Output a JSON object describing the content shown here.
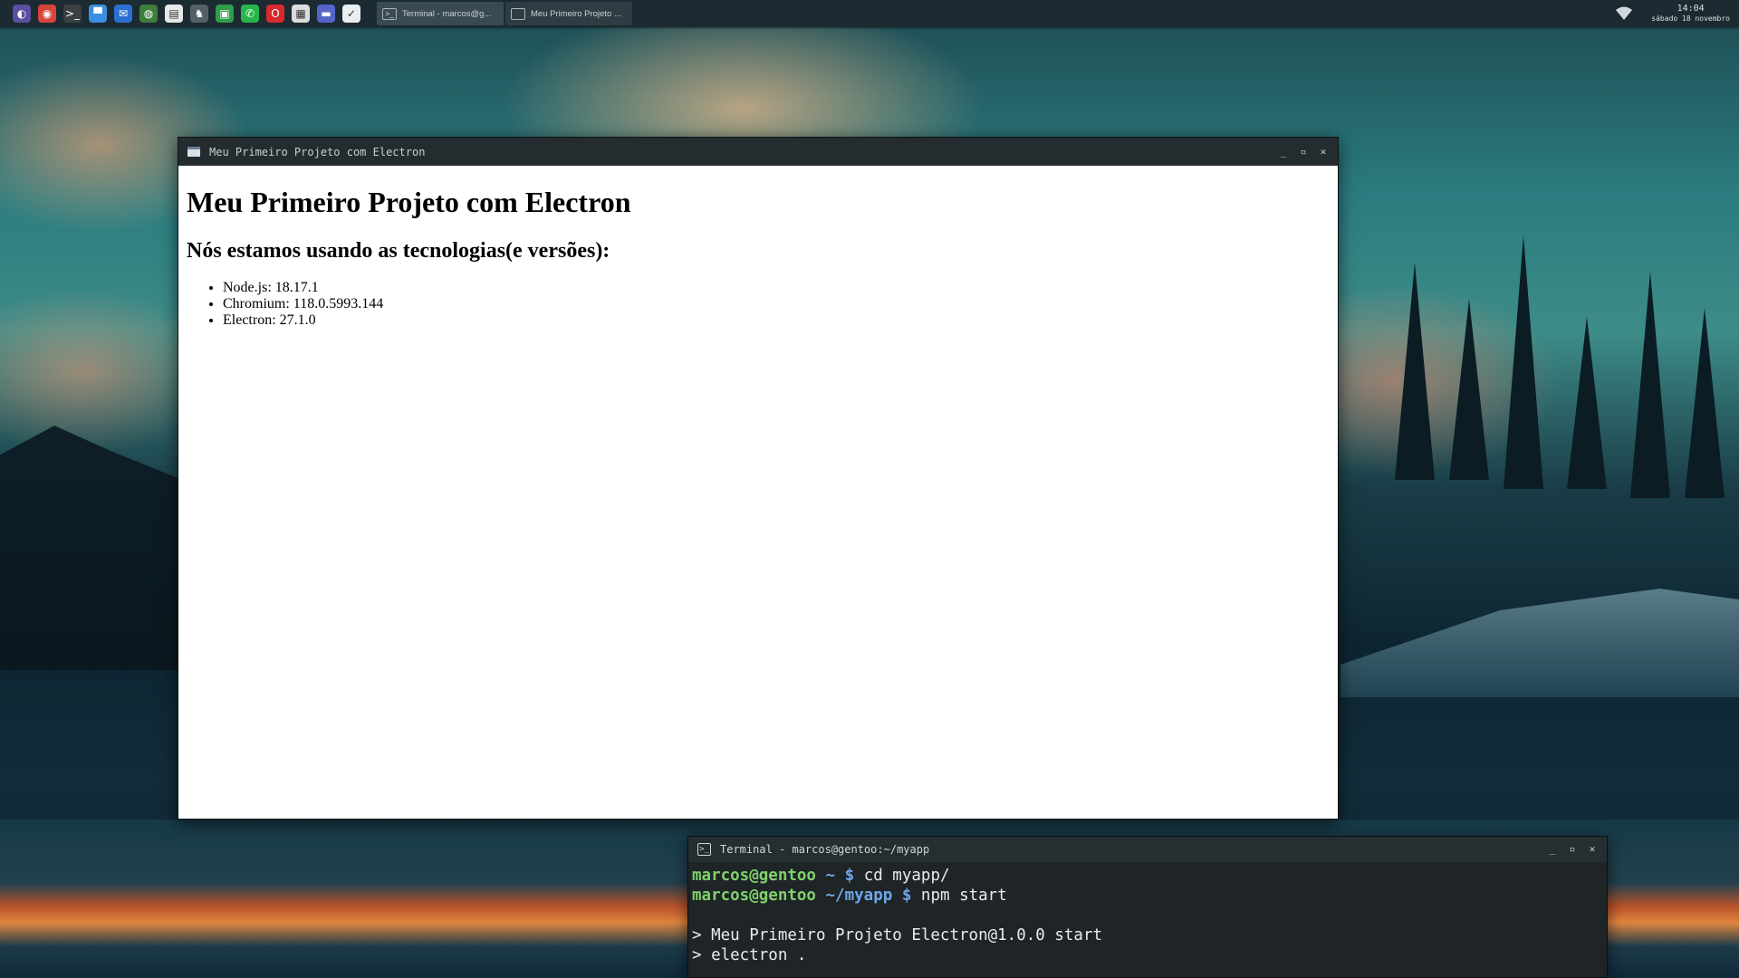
{
  "taskbar": {
    "launchers": [
      {
        "name": "gentoo-launcher-icon",
        "glyph": "◐",
        "color": "#5a4fa0"
      },
      {
        "name": "chrome-icon",
        "glyph": "◉",
        "color": "#d9453a"
      },
      {
        "name": "terminal-launcher-icon",
        "glyph": ">_",
        "color": "#3a3f44"
      },
      {
        "name": "folder-icon",
        "glyph": "▀",
        "color": "#3b8fe0"
      },
      {
        "name": "thunderbird-icon",
        "glyph": "✉",
        "color": "#2c6fd1"
      },
      {
        "name": "firefox-icon",
        "glyph": "◍",
        "color": "#3e7d3a"
      },
      {
        "name": "document-icon",
        "glyph": "▤",
        "color": "#e8e8e8"
      },
      {
        "name": "game-icon",
        "glyph": "♞",
        "color": "#555f66"
      },
      {
        "name": "code-editor-icon",
        "glyph": "▣",
        "color": "#2f9e4a"
      },
      {
        "name": "whatsapp-icon",
        "glyph": "✆",
        "color": "#26b64a"
      },
      {
        "name": "opera-icon",
        "glyph": "O",
        "color": "#d8292e"
      },
      {
        "name": "notes-icon",
        "glyph": "▦",
        "color": "#dcdcdc"
      },
      {
        "name": "media-icon",
        "glyph": "▬",
        "color": "#5664c9"
      },
      {
        "name": "pocket-icon",
        "glyph": "✓",
        "color": "#e9eef0"
      }
    ],
    "tasks": [
      {
        "label": "Terminal - marcos@g...",
        "icon": ">_"
      },
      {
        "label": "Meu Primeiro Projeto ...",
        "icon": ""
      }
    ],
    "clock": {
      "time": "14:04",
      "date": "sábado 18 novembro"
    }
  },
  "app_window": {
    "title": "Meu Primeiro Projeto com Electron",
    "heading": "Meu Primeiro Projeto com Electron",
    "subheading": "Nós estamos usando as tecnologias(e versões):",
    "versions": [
      "Node.js: 18.17.1",
      "Chromium: 118.0.5993.144",
      "Electron: 27.1.0"
    ]
  },
  "terminal": {
    "title": "Terminal - marcos@gentoo:~/myapp",
    "lines": [
      {
        "user": "marcos@gentoo",
        "path": "~",
        "prompt": "$",
        "cmd": "cd myapp/"
      },
      {
        "user": "marcos@gentoo",
        "path": "~/myapp",
        "prompt": "$",
        "cmd": "npm start"
      }
    ],
    "output": [
      "",
      "> Meu Primeiro Projeto Electron@1.0.0 start",
      "> electron ."
    ]
  },
  "window_buttons": {
    "minimize": "_",
    "maximize": "▫",
    "close": "✕"
  }
}
